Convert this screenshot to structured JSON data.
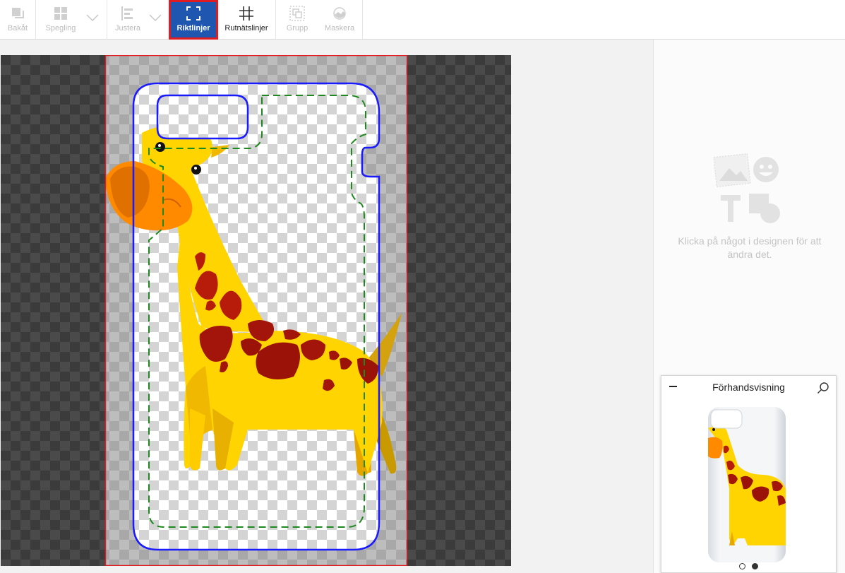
{
  "toolbar": {
    "items": [
      {
        "label": "Bakåt",
        "icon": "send-backward-icon"
      },
      {
        "label": "Spegling",
        "icon": "mirror-icon"
      },
      {
        "label": "Justera",
        "icon": "align-icon"
      },
      {
        "label": "Riktlinjer",
        "icon": "guidelines-icon",
        "active": true
      },
      {
        "label": "Rutnätslinjer",
        "icon": "grid-icon"
      },
      {
        "label": "Grupp",
        "icon": "group-icon"
      },
      {
        "label": "Maskera",
        "icon": "mask-icon"
      }
    ]
  },
  "side_panel": {
    "hint": "Klicka på något i designen för att ändra det."
  },
  "preview": {
    "title": "Förhandsvisning"
  },
  "colors": {
    "active_bg": "#1f56b0",
    "active_border": "#e01b22",
    "cut_line": "#1a1aff",
    "safe_line": "#1e8a1e",
    "bleed_line": "#e01b22"
  }
}
